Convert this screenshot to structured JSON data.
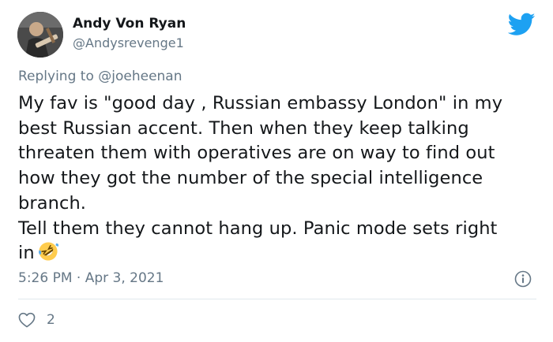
{
  "user": {
    "name": "Andy Von Ryan",
    "handle": "@Andysrevenge1"
  },
  "reply": {
    "prefix": "Replying to ",
    "to": "@joeheenan"
  },
  "tweet": {
    "text_main": "My fav is \"good day , Russian embassy London\" in my\nbest Russian accent. Then when they keep talking\nthreaten them with operatives are on way to find out\nhow they got the number of the special intelligence\nbranch.\nTell them they cannot hang up. Panic mode sets right\nin",
    "emoji": "rolling-on-floor-laughing-emoji",
    "timestamp": "5:26 PM · Apr 3, 2021"
  },
  "stats": {
    "likes": "2"
  },
  "colors": {
    "twitter_blue": "#1da1f2",
    "secondary_text": "#657786",
    "divider": "#e1e8ed"
  }
}
